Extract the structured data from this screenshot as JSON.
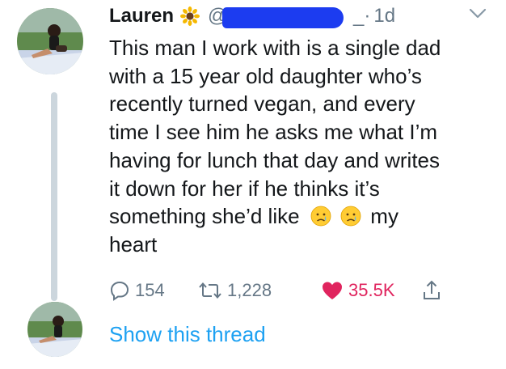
{
  "tweet": {
    "author_name": "Lauren",
    "handle_visible": "@",
    "handle_suffix": "_",
    "separator": "·",
    "timestamp": "1d",
    "text_lines": [
      "This man I work with is a single dad",
      "with a 15 year old daughter who’s",
      "recently turned vegan, and every",
      "time I see him he asks me what I’m",
      "having for lunch that day and writes",
      "it down for her if he thinks it’s",
      "something she’d like",
      "my",
      "heart"
    ],
    "icons": [
      "sunflower-icon",
      "chevron-down-icon",
      "crying-face-icon",
      "reply-icon",
      "retweet-icon",
      "heart-icon",
      "share-icon"
    ]
  },
  "actions": {
    "reply_count": "154",
    "retweet_count": "1,228",
    "like_count": "35.5K"
  },
  "thread": {
    "show_label": "Show this thread"
  },
  "colors": {
    "text": "#14171a",
    "muted": "#657786",
    "like": "#e0245e",
    "link": "#1da1f2",
    "thread_line": "#ccd6dd",
    "redaction": "#1c3cf0"
  }
}
